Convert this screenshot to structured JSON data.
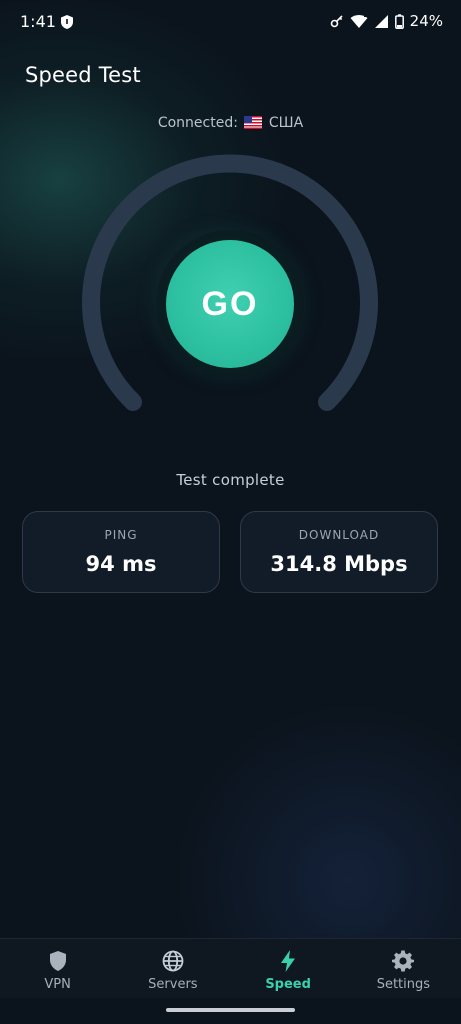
{
  "status_bar": {
    "time": "1:41",
    "battery": "24%",
    "icons": [
      "vpn-key-icon",
      "wifi-icon",
      "signal-icon",
      "battery-icon"
    ]
  },
  "header": {
    "title": "Speed Test"
  },
  "connection": {
    "label": "Connected:",
    "country": "США",
    "flag_icon": "us-flag-icon"
  },
  "gauge": {
    "button_label": "GO"
  },
  "test": {
    "status": "Test complete"
  },
  "stats": {
    "ping": {
      "label": "PING",
      "value": "94 ms"
    },
    "download": {
      "label": "DOWNLOAD",
      "value": "314.8 Mbps"
    }
  },
  "nav": {
    "items": [
      {
        "label": "VPN",
        "icon": "shield-icon",
        "active": false
      },
      {
        "label": "Servers",
        "icon": "globe-icon",
        "active": false
      },
      {
        "label": "Speed",
        "icon": "lightning-icon",
        "active": true
      },
      {
        "label": "Settings",
        "icon": "gear-icon",
        "active": false
      }
    ]
  },
  "colors": {
    "background": "#0b131c",
    "accent": "#3ccfae",
    "gauge_track": "#2a3a4c",
    "card_border": "#2e3a48"
  }
}
